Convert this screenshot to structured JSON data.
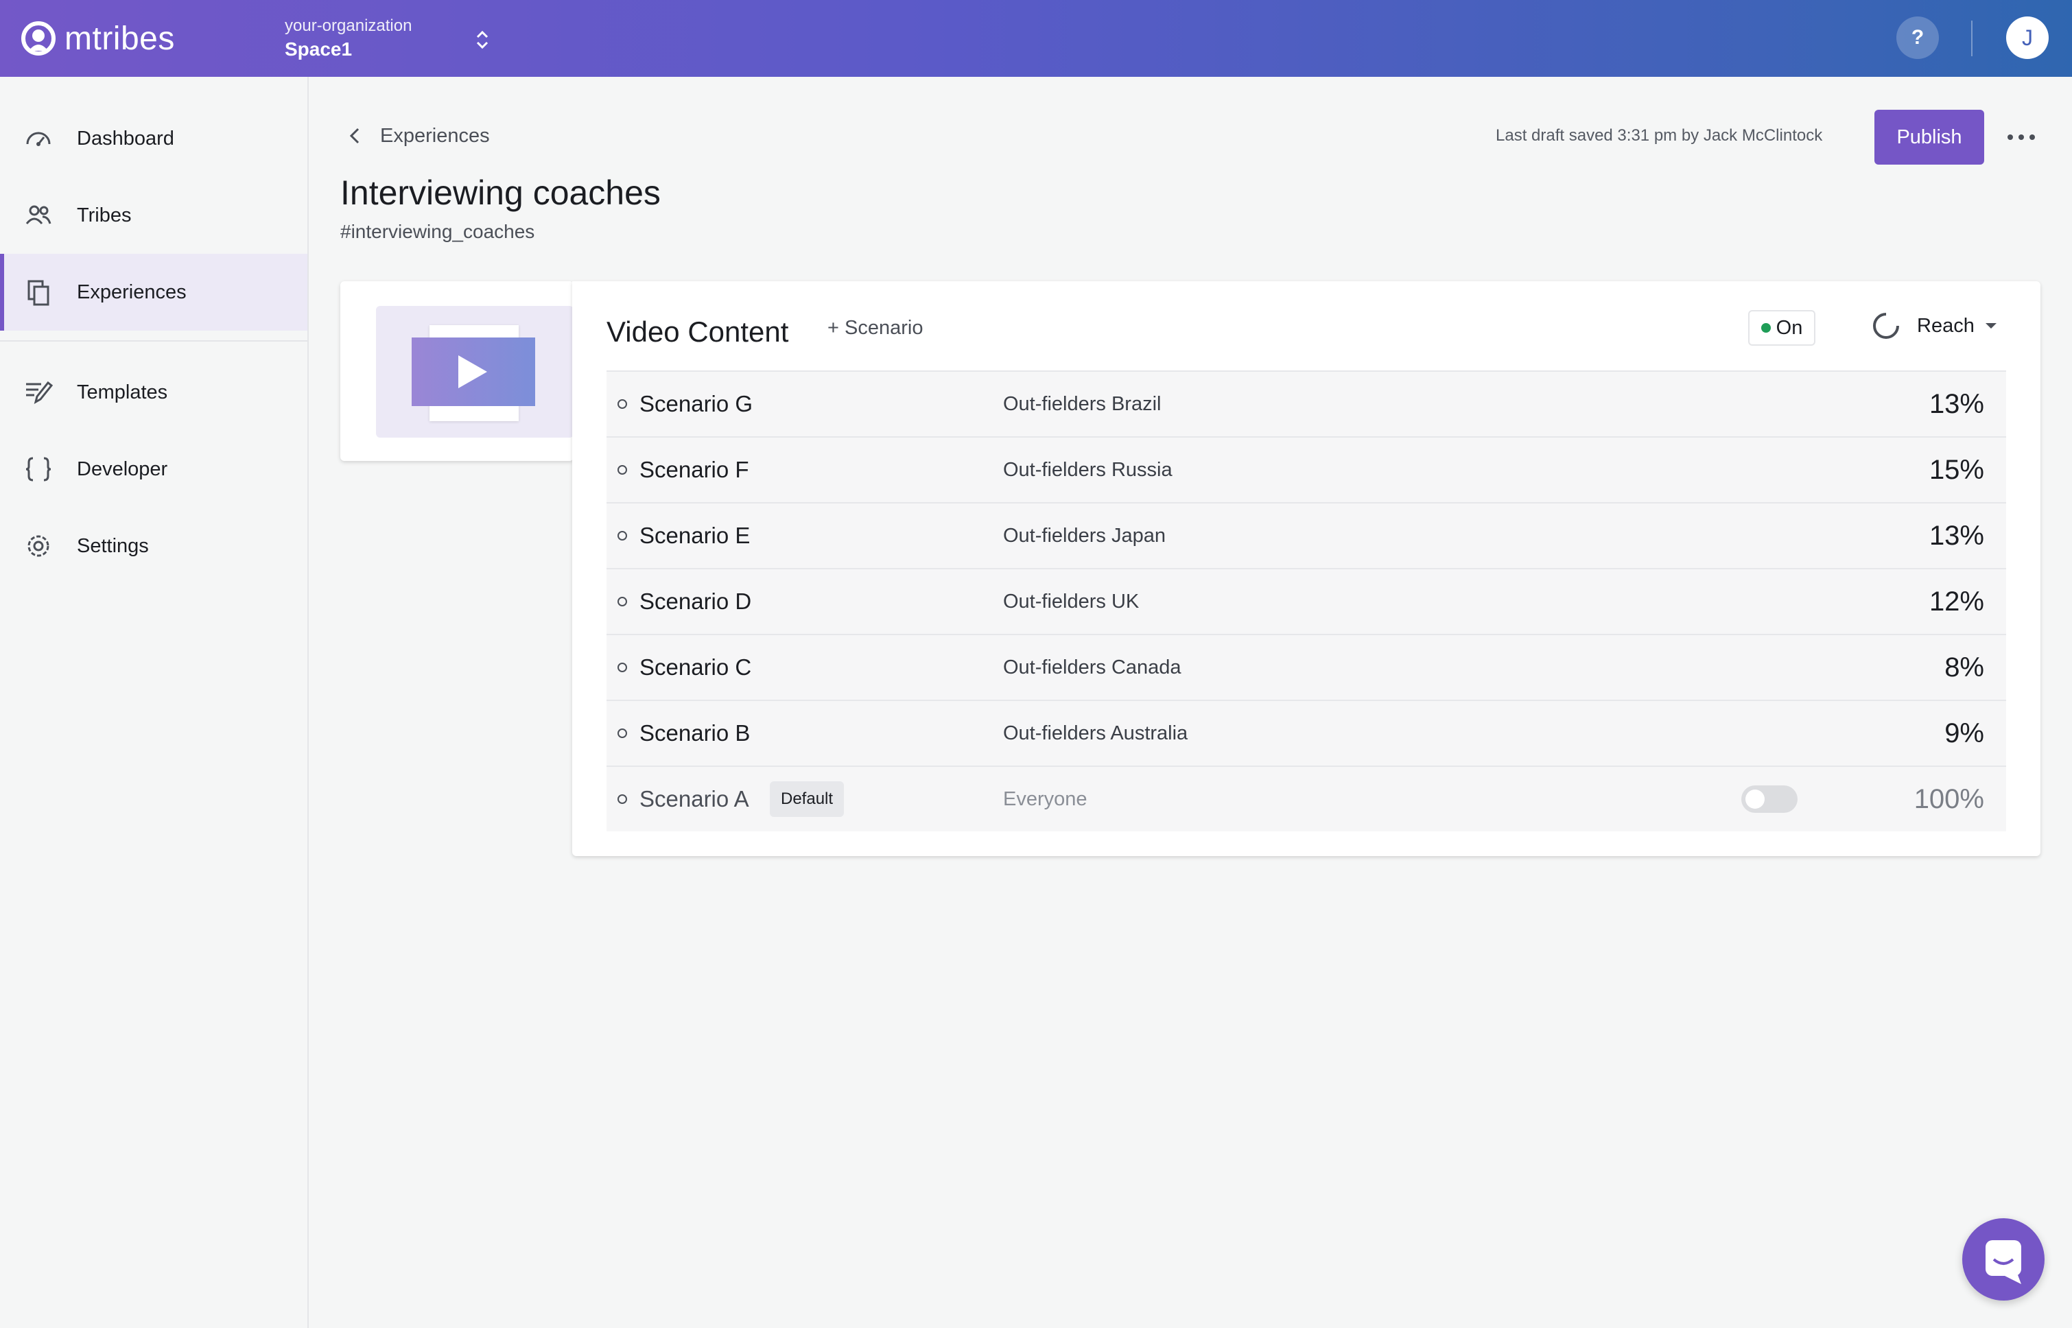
{
  "app": {
    "logo_text": "mtribes",
    "org_name": "your-organization",
    "space_name": "Space1",
    "help_label": "?",
    "avatar_initial": "J"
  },
  "sidebar": {
    "items": [
      {
        "label": "Dashboard",
        "icon": "dashboard-icon"
      },
      {
        "label": "Tribes",
        "icon": "tribes-icon"
      },
      {
        "label": "Experiences",
        "icon": "experiences-icon",
        "active": true
      },
      {
        "label": "Templates",
        "icon": "templates-icon"
      },
      {
        "label": "Developer",
        "icon": "developer-icon"
      },
      {
        "label": "Settings",
        "icon": "settings-icon"
      }
    ]
  },
  "header": {
    "back_label": "Experiences",
    "saved_text": "Last draft saved 3:31 pm by Jack McClintock",
    "publish_label": "Publish",
    "title": "Interviewing coaches",
    "slug": "#interviewing_coaches"
  },
  "experience": {
    "name": "Video Content",
    "add_scenario_label": "+  Scenario",
    "status_label": "On",
    "reach_label": "Reach",
    "scenarios": [
      {
        "name": "Scenario G",
        "tribe": "Out-fielders Brazil",
        "reach": "13%"
      },
      {
        "name": "Scenario F",
        "tribe": "Out-fielders Russia",
        "reach": "15%"
      },
      {
        "name": "Scenario E",
        "tribe": "Out-fielders Japan",
        "reach": "13%"
      },
      {
        "name": "Scenario D",
        "tribe": "Out-fielders UK",
        "reach": "12%"
      },
      {
        "name": "Scenario C",
        "tribe": "Out-fielders Canada",
        "reach": "8%"
      },
      {
        "name": "Scenario B",
        "tribe": "Out-fielders Australia",
        "reach": "9%"
      },
      {
        "name": "Scenario A",
        "badge": "Default",
        "tribe": "Everyone",
        "reach": "100%",
        "toggle_on": false
      }
    ]
  },
  "colors": {
    "accent": "#7556c6",
    "status_on": "#1f9d57"
  }
}
